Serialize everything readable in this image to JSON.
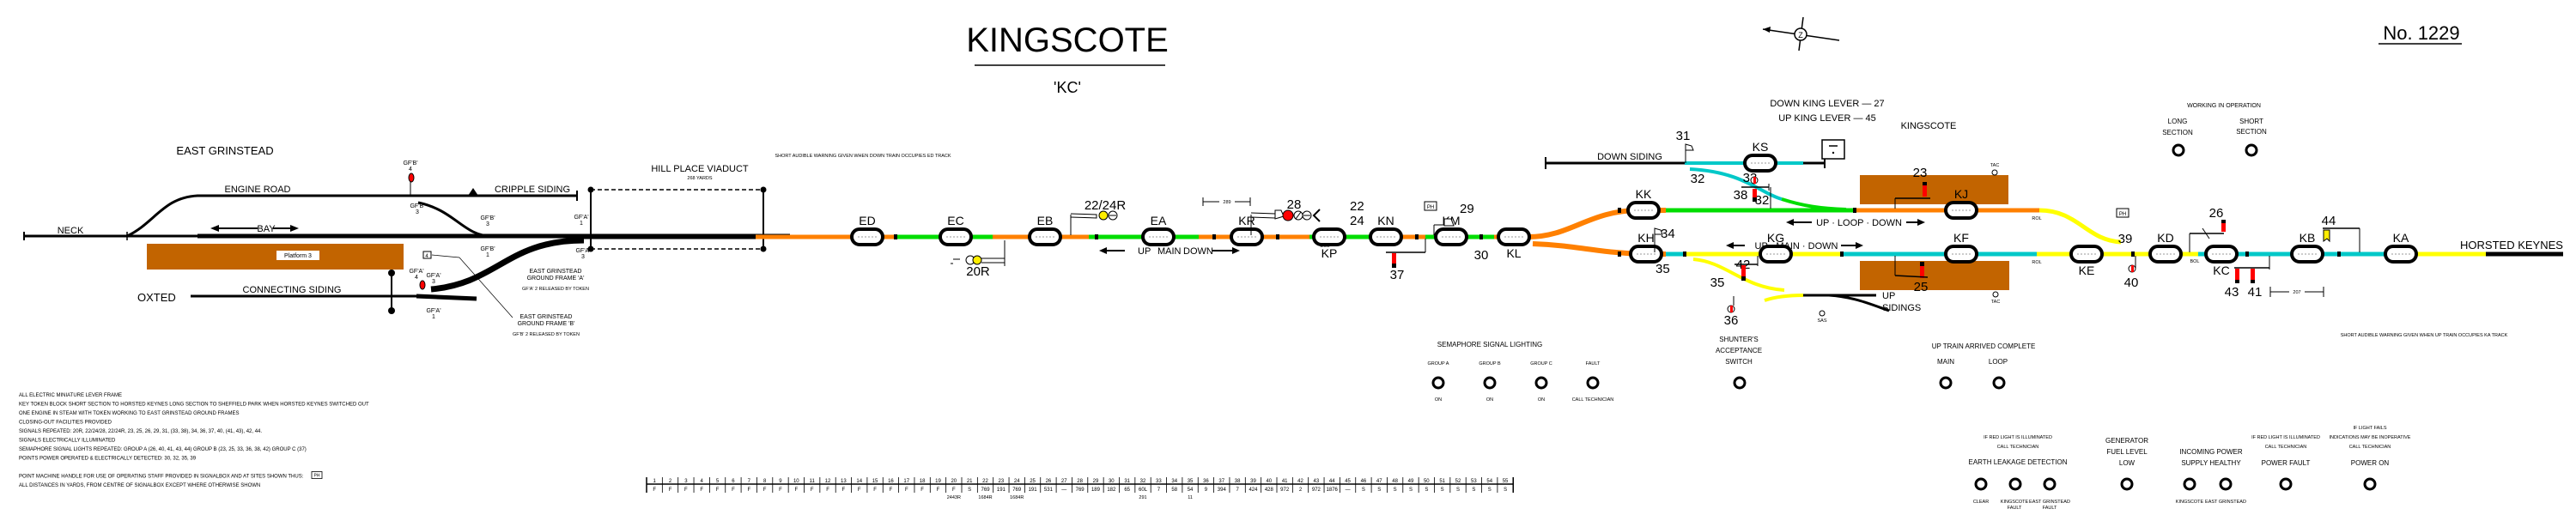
{
  "header": {
    "title": "KINGSCOTE",
    "code": "'KC'",
    "diagram_number": "No. 1229",
    "compass_icon": "north-arrow-icon"
  },
  "colors": {
    "track_unoccupied_black": "#000000",
    "track_orange": "#ff8000",
    "track_green": "#00dd00",
    "track_yellow": "#ffff00",
    "track_cyan": "#00c8c8",
    "platform": "#c26400",
    "signal_red": "#ff0000",
    "signal_yellow": "#ffee00"
  },
  "locations": {
    "west_terminus": "EAST GRINSTEAD",
    "east_terminus": "HORSTED KEYNES",
    "oxted": "OXTED",
    "station": "KINGSCOTE",
    "viaduct": "HILL PLACE VIADUCT",
    "viaduct_length": "268 YARDS"
  },
  "east_grinstead_area": {
    "neck": "NECK",
    "engine_road": "ENGINE ROAD",
    "cripple_siding": "CRIPPLE SIDING",
    "bay": "BAY",
    "platform": "Platform 3",
    "connecting_siding": "CONNECTING SIDING",
    "gf_labels": {
      "gfb4": "GF'B'",
      "gfb4n": "4",
      "gfb3a": "GF'B'",
      "gfb3an": "3",
      "gfb3b": "GF'B'",
      "gfb3bn": "3",
      "gfb1": "GF'B'",
      "gfb1n": "1",
      "gfa1": "GF'A'",
      "gfa1n": "1",
      "gfa3": "GF'A'",
      "gfa3n": "3",
      "gfa4": "GF'A'",
      "gfa4n": "4",
      "gfa3b": "GF'A'",
      "gfa3bn": "3",
      "gfa1b": "GF'A'",
      "gfa1bn": "1"
    },
    "token_box": "4",
    "gf_a_title_1": "EAST GRINSTEAD",
    "gf_a_title_2": "GROUND FRAME 'A'",
    "gf_a_note": "GF'A' 2 RELEASED BY TOKEN",
    "gf_b_title_1": "EAST GRINSTEAD",
    "gf_b_title_2": "GROUND FRAME 'B'",
    "gf_b_note": "GF'B' 2 RELEASED BY TOKEN"
  },
  "notes": {
    "down_warning": "SHORT AUDIBLE WARNING GIVEN WHEN DOWN TRAIN OCCUPIES ED TRACK",
    "up_warning": "SHORT AUDIBLE WARNING GIVEN WHEN UP TRAIN OCCUPIES KA TRACK",
    "down_king_lever": "DOWN KING LEVER  —  27",
    "up_king_lever": "UP KING LEVER  —  45",
    "general": [
      "ALL ELECTRIC MINIATURE LEVER FRAME",
      "KEY TOKEN BLOCK SHORT SECTION TO HORSTED KEYNES LONG SECTION TO SHEFFIELD PARK WHEN HORSTED KEYNES SWITCHED OUT",
      "ONE ENGINE IN STEAM WITH TOKEN WORKING TO EAST GRINSTEAD GROUND FRAMES",
      "CLOSING-OUT FACILITIES PROVIDED",
      "SIGNALS REPEATED:  20R, 22/24/28, 22/24R, 23, 25, 26, 29, 31, (33, 38), 34, 36, 37, 40, (41, 43), 42, 44.",
      "SIGNALS ELECTRICALLY ILLUMINATED",
      "SEMAPHORE SIGNAL LIGHTS REPEATED:  GROUP A (26, 40, 41, 43, 44)   GROUP B (23, 25, 33, 36, 38, 42)  GROUP C (37)",
      "POINTS POWER OPERATED & ELECTRICALLY DETECTED:  30, 32, 35, 39",
      "",
      "POINT MACHINE HANDLE FOR USE OF OPERATING STAFF PROVIDED IN SIGNALBOX AND AT SITES SHOWN THUS:",
      "ALL DISTANCES IN YARDS, FROM CENTRE OF SIGNALBOX EXCEPT WHERE OTHERWISE SHOWN"
    ],
    "ph_box": "PH"
  },
  "track_labels": {
    "up_main_down_west": [
      "UP",
      "MAIN",
      "DOWN"
    ],
    "up_loop_down": "UP  ·  LOOP  ·  DOWN",
    "up_main_down_east": "UP  ·  MAIN  ·  DOWN",
    "down_siding": "DOWN SIDING",
    "up_sidings_1": "UP",
    "up_sidings_2": "SIDINGS",
    "dist_289": "289",
    "dist_207": "207",
    "bol": "BOL",
    "rol": "ROL",
    "tac": "TAC",
    "sas": "SAS"
  },
  "track_circuits": [
    "ED",
    "EC",
    "EB",
    "EA",
    "KR",
    "KP",
    "KN",
    "KM",
    "KL",
    "KK",
    "KS",
    "KJ",
    "KH",
    "KG",
    "KF",
    "KE",
    "KD",
    "KC",
    "KB",
    "KA"
  ],
  "signals": {
    "s20r": "20R",
    "s22_24r": "22/24R",
    "s28": "28",
    "s22": "22",
    "s24": "24",
    "s37": "37",
    "s29": "29",
    "s30": "30",
    "s31": "31",
    "s32a": "32",
    "s32b": "32",
    "s33": "33",
    "s38": "38",
    "s23": "23",
    "s34": "34",
    "s35a": "35",
    "s35b": "35",
    "s42": "42",
    "s36": "36",
    "s25": "25",
    "s39": "39",
    "s40": "40",
    "s26": "26",
    "s43": "43",
    "s41": "41",
    "s44": "44"
  },
  "indicators": {
    "working_title": "WORKING IN OPERATION",
    "long_section": [
      "LONG",
      "SECTION"
    ],
    "short_section": [
      "SHORT",
      "SECTION"
    ],
    "semaphore_lighting_title": "SEMAPHORE SIGNAL LIGHTING",
    "semaphore_groups": [
      {
        "label": "GROUP A",
        "state": "ON"
      },
      {
        "label": "GROUP B",
        "state": "ON"
      },
      {
        "label": "GROUP C",
        "state": "ON"
      },
      {
        "label": "FAULT",
        "state": "CALL TECHNICIAN"
      }
    ],
    "shunters_switch": [
      "SHUNTER'S",
      "ACCEPTANCE",
      "SWITCH"
    ],
    "up_train_title": "UP TRAIN ARRIVED COMPLETE",
    "up_train_main": "MAIN",
    "up_train_loop": "LOOP",
    "earth_leakage_note_1": "IF RED LIGHT IS ILLUMINATED",
    "earth_leakage_note_2": "CALL TECHNICIAN",
    "earth_leakage_title": "EARTH LEAKAGE DETECTION",
    "earth_leakage_lamps": [
      {
        "label1": "CLEAR",
        "label2": ""
      },
      {
        "label1": "KINGSCOTE",
        "label2": "FAULT"
      },
      {
        "label1": "EAST GRINSTEAD",
        "label2": "FAULT"
      }
    ],
    "generator": [
      "GENERATOR",
      "FUEL LEVEL",
      "LOW"
    ],
    "incoming_power": [
      "INCOMING POWER",
      "SUPPLY HEALTHY"
    ],
    "incoming_power_lamps": [
      "KINGSCOTE",
      "EAST GRINSTEAD"
    ],
    "power_fault_note_1": "IF RED LIGHT IS ILLUMINATED",
    "power_fault_note_2": "CALL TECHNICIAN",
    "power_fault": "POWER FAULT",
    "power_on_note_1": "IF LIGHT FAILS",
    "power_on_note_2": "INDICATIONS MAY BE INOPERATIVE",
    "power_on_note_3": "CALL TECHNICIAN",
    "power_on": "POWER ON"
  },
  "lever_table": {
    "levers": [
      "1",
      "2",
      "3",
      "4",
      "5",
      "6",
      "7",
      "8",
      "9",
      "10",
      "11",
      "12",
      "13",
      "14",
      "15",
      "16",
      "17",
      "18",
      "19",
      "20",
      "21",
      "22",
      "23",
      "24",
      "25",
      "26",
      "27",
      "28",
      "29",
      "30",
      "31",
      "32",
      "33",
      "34",
      "35",
      "36",
      "37",
      "38",
      "39",
      "40",
      "41",
      "42",
      "43",
      "44",
      "45",
      "46",
      "47",
      "48",
      "49",
      "50",
      "51",
      "52",
      "53",
      "54",
      "55"
    ],
    "values": [
      "F",
      "F",
      "F",
      "F",
      "F",
      "F",
      "F",
      "F",
      "F",
      "F",
      "F",
      "F",
      "F",
      "F",
      "F",
      "F",
      "F",
      "F",
      "F",
      "F",
      "S",
      "769",
      "191",
      "769",
      "191",
      "531",
      "—",
      "769",
      "189",
      "182",
      "65",
      "60L",
      "7",
      "58",
      "54",
      "9",
      "394",
      "7",
      "424",
      "428",
      "972",
      "2",
      "972",
      "1876",
      "—",
      "S",
      "S",
      "S",
      "S",
      "S",
      "S",
      "S",
      "S",
      "S",
      "S"
    ],
    "extra": [
      "",
      "",
      "",
      "",
      "",
      "",
      "",
      "",
      "",
      "",
      "",
      "",
      "",
      "",
      "",
      "",
      "",
      "",
      "",
      "2443R",
      "",
      "1684R",
      "",
      "1684R",
      "",
      "",
      "",
      "",
      "",
      "",
      "",
      "291",
      "",
      "",
      "11",
      "",
      "",
      "",
      "",
      "",
      "",
      "",
      "",
      "",
      "",
      "",
      "",
      "",
      "",
      "",
      "",
      "",
      "",
      "",
      ""
    ]
  }
}
